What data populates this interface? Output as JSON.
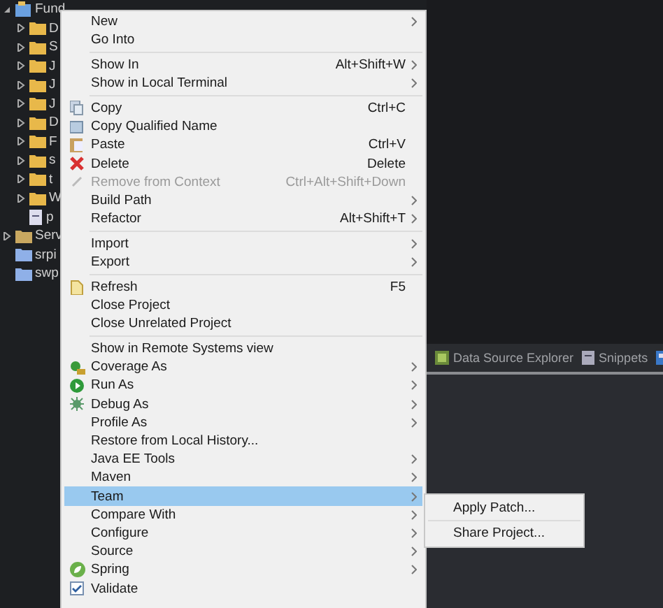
{
  "tree": {
    "label": "Fund",
    "expanded": true,
    "children": [
      {
        "label": "D",
        "kind": "folder",
        "expanded": false
      },
      {
        "label": "S",
        "kind": "folder",
        "expanded": false
      },
      {
        "label": "J",
        "kind": "folder",
        "expanded": false
      },
      {
        "label": "J",
        "kind": "folder",
        "expanded": false
      },
      {
        "label": "J",
        "kind": "folder",
        "expanded": false
      },
      {
        "label": "D",
        "kind": "folder",
        "expanded": false
      },
      {
        "label": "F",
        "kind": "folder",
        "expanded": false
      },
      {
        "label": "s",
        "kind": "folder",
        "expanded": false
      },
      {
        "label": "t",
        "kind": "folder",
        "expanded": false
      },
      {
        "label": "W",
        "kind": "folder",
        "expanded": false
      },
      {
        "label": "p",
        "kind": "file"
      }
    ]
  },
  "projects": [
    {
      "label": "Serv",
      "kind": "folder",
      "expanded": false
    },
    {
      "label": "srpi",
      "kind": "project"
    },
    {
      "label": "swp",
      "kind": "project"
    }
  ],
  "panel_tabs": [
    {
      "label": "Data Source Explorer",
      "selected": false
    },
    {
      "label": "Snippets",
      "selected": false
    }
  ],
  "menu": {
    "groups": [
      [
        {
          "label": "New",
          "submenu": true,
          "disabled": false,
          "selected": false
        },
        {
          "label": "Go Into",
          "submenu": false,
          "disabled": false,
          "selected": false
        }
      ],
      [
        {
          "label": "Show In",
          "shortcut": "Alt+Shift+W",
          "submenu": true,
          "disabled": false,
          "selected": false
        },
        {
          "label": "Show in Local Terminal",
          "submenu": true,
          "disabled": false,
          "selected": false
        }
      ],
      [
        {
          "label": "Copy",
          "shortcut": "Ctrl+C",
          "submenu": false,
          "disabled": false,
          "selected": false
        },
        {
          "label": "Copy Qualified Name",
          "submenu": false,
          "disabled": false,
          "selected": false
        },
        {
          "label": "Paste",
          "shortcut": "Ctrl+V",
          "submenu": false,
          "disabled": false,
          "selected": false
        },
        {
          "label": "Delete",
          "shortcut": "Delete",
          "submenu": false,
          "disabled": false,
          "selected": false
        },
        {
          "label": "Remove from Context",
          "shortcut": "Ctrl+Alt+Shift+Down",
          "submenu": false,
          "disabled": true,
          "selected": false
        },
        {
          "label": "Build Path",
          "submenu": true,
          "disabled": false,
          "selected": false
        },
        {
          "label": "Refactor",
          "shortcut": "Alt+Shift+T",
          "submenu": true,
          "disabled": false,
          "selected": false
        }
      ],
      [
        {
          "label": "Import",
          "submenu": true,
          "disabled": false,
          "selected": false
        },
        {
          "label": "Export",
          "submenu": true,
          "disabled": false,
          "selected": false
        }
      ],
      [
        {
          "label": "Refresh",
          "shortcut": "F5",
          "submenu": false,
          "disabled": false,
          "selected": false
        },
        {
          "label": "Close Project",
          "submenu": false,
          "disabled": false,
          "selected": false
        },
        {
          "label": "Close Unrelated Project",
          "submenu": false,
          "disabled": false,
          "selected": false
        }
      ],
      [
        {
          "label": "Show in Remote Systems view",
          "submenu": false,
          "disabled": false,
          "selected": false
        },
        {
          "label": "Coverage As",
          "submenu": true,
          "disabled": false,
          "selected": false
        },
        {
          "label": "Run As",
          "submenu": true,
          "disabled": false,
          "selected": false
        },
        {
          "label": "Debug As",
          "submenu": true,
          "disabled": false,
          "selected": false
        },
        {
          "label": "Profile As",
          "submenu": true,
          "disabled": false,
          "selected": false
        },
        {
          "label": "Restore from Local History...",
          "submenu": false,
          "disabled": false,
          "selected": false
        },
        {
          "label": "Java EE Tools",
          "submenu": true,
          "disabled": false,
          "selected": false
        },
        {
          "label": "Maven",
          "submenu": true,
          "disabled": false,
          "selected": false
        },
        {
          "label": "Team",
          "submenu": true,
          "disabled": false,
          "selected": true
        },
        {
          "label": "Compare With",
          "submenu": true,
          "disabled": false,
          "selected": false
        },
        {
          "label": "Configure",
          "submenu": true,
          "disabled": false,
          "selected": false
        },
        {
          "label": "Source",
          "submenu": true,
          "disabled": false,
          "selected": false
        },
        {
          "label": "Spring",
          "submenu": true,
          "disabled": false,
          "selected": false
        },
        {
          "label": "Validate",
          "submenu": false,
          "disabled": false,
          "selected": false
        }
      ]
    ]
  },
  "submenu": {
    "groups": [
      [
        {
          "label": "Apply Patch..."
        }
      ],
      [
        {
          "label": "Share Project..."
        }
      ]
    ]
  }
}
